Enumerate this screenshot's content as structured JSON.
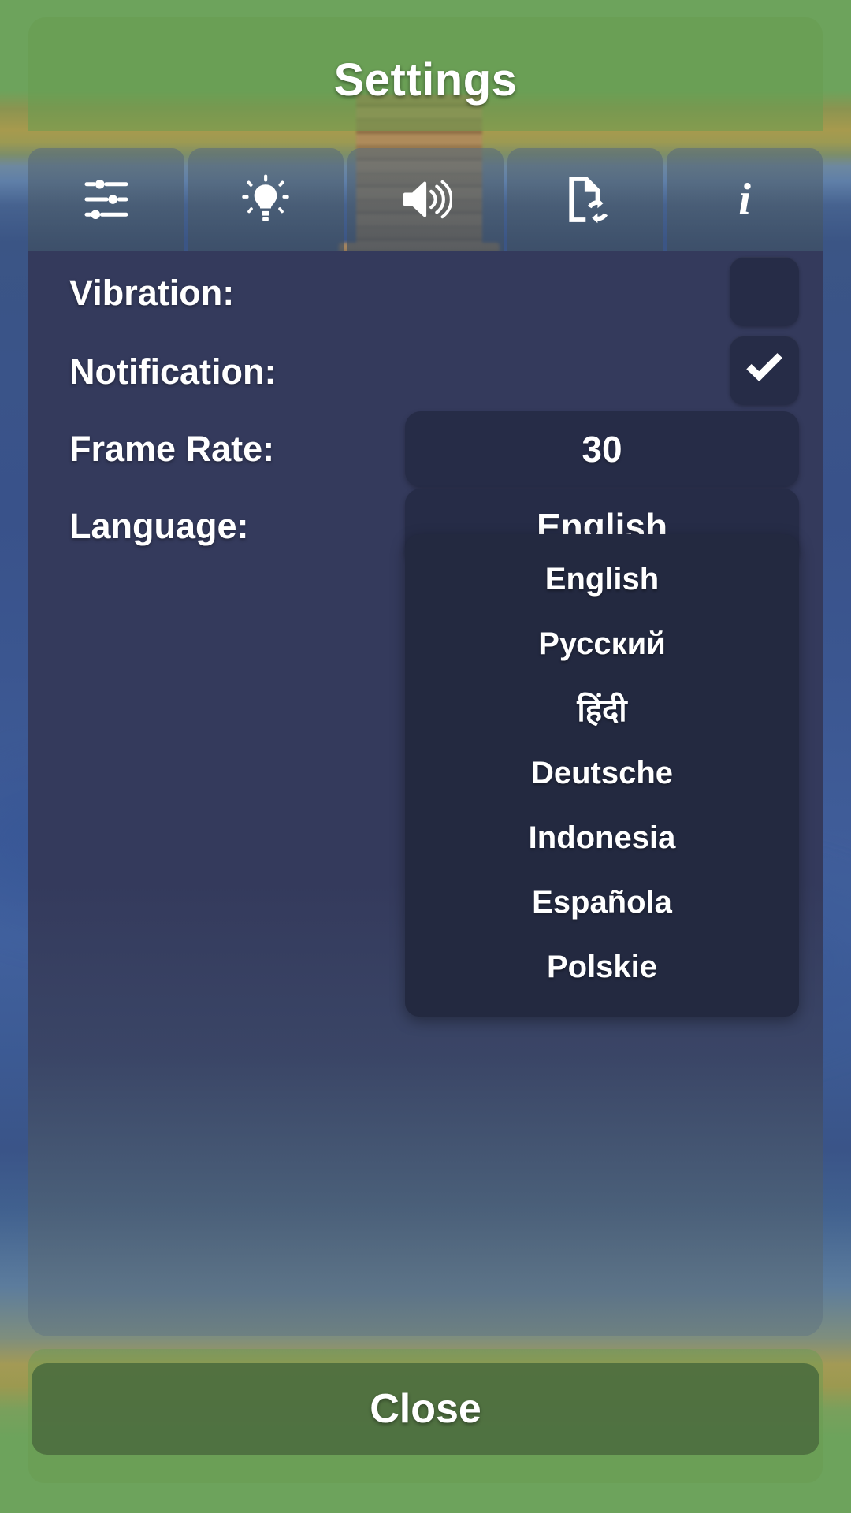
{
  "window": {
    "title": "Settings"
  },
  "tabs": [
    {
      "icon": "sliders-icon",
      "name": "tab-general"
    },
    {
      "icon": "lightbulb-icon",
      "name": "tab-graphics"
    },
    {
      "icon": "speaker-icon",
      "name": "tab-sound"
    },
    {
      "icon": "document-sync-icon",
      "name": "tab-data"
    },
    {
      "icon": "info-icon",
      "name": "tab-info",
      "glyph": "i"
    }
  ],
  "settings": {
    "vibration": {
      "label": "Vibration:",
      "checked": false
    },
    "notification": {
      "label": "Notification:",
      "checked": true
    },
    "frame_rate": {
      "label": "Frame Rate:",
      "value": "30"
    },
    "language": {
      "label": "Language:",
      "value": "English",
      "options": [
        "English",
        "Русский",
        "हिंदी",
        "Deutsche",
        "Indonesia",
        "Española",
        "Polskie"
      ]
    }
  },
  "footer": {
    "close_label": "Close"
  },
  "colors": {
    "panel_bg": "#343a5c",
    "control_bg": "#262c47",
    "dropdown_bg": "#232940",
    "header_green": "#689c50",
    "close_green": "#4d6e3f",
    "text": "#ffffff"
  }
}
